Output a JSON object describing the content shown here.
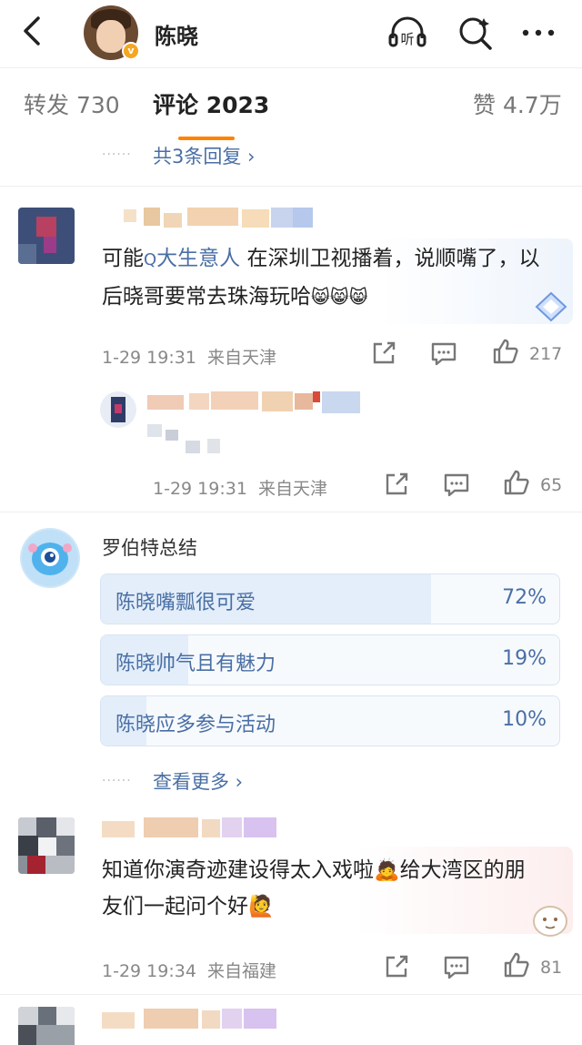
{
  "header": {
    "name": "陈晓",
    "verified_badge": "v",
    "icons": [
      "back-icon",
      "listen-icon",
      "search-icon",
      "more-icon"
    ],
    "listen_label": "听"
  },
  "tabs": {
    "repost": "转发 730",
    "comments": "评论 2023",
    "likes": "赞 4.7万",
    "accent": "#ff8200"
  },
  "prev_replies": "共3条回复 ›",
  "comment1": {
    "text_before": "可能",
    "topic_icon": "Q",
    "topic": "大生意人",
    "text_after": " 在深圳卫视播着，说顺嘴了，以后晓哥要常去珠海玩哈",
    "emoji": "😸😸😸",
    "time": "1-29 19:31",
    "location": "来自天津",
    "likes": "217"
  },
  "reply1": {
    "time": "1-29 19:31",
    "location": "来自天津",
    "likes": "65"
  },
  "robot": {
    "name": "罗伯特总结",
    "options": [
      {
        "label": "陈晓嘴瓢很可爱",
        "pct": "72%",
        "value": 72
      },
      {
        "label": "陈晓帅气且有魅力",
        "pct": "19%",
        "value": 19
      },
      {
        "label": "陈晓应多参与活动",
        "pct": "10%",
        "value": 10
      }
    ],
    "see_more": "查看更多 ›"
  },
  "comment2": {
    "text": "知道你演奇迹建设得太入戏啦🙇给大湾区的朋友们一起问个好🙋",
    "time": "1-29 19:34",
    "location": "来自福建",
    "likes": "81"
  },
  "colors": {
    "link": "#4a6fa5",
    "meta": "#888888",
    "poll_fill": "#e3eefa"
  }
}
